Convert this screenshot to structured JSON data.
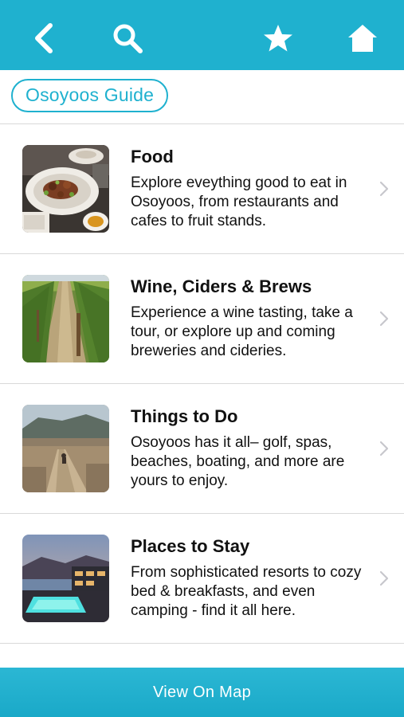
{
  "header": {
    "back_icon": "chevron-left-icon",
    "search_icon": "search-icon",
    "favorite_icon": "star-icon",
    "home_icon": "home-icon",
    "color": "#1fb1cf"
  },
  "breadcrumb": {
    "label": "Osoyoos Guide"
  },
  "categories": [
    {
      "title": "Food",
      "description": "Explore eveything good to eat in Osoyoos, from restaurants and cafes to fruit stands.",
      "thumbnail": "food-photo"
    },
    {
      "title": "Wine, Ciders & Brews",
      "description": "Experience a wine tasting, take a tour, or explore up and coming breweries and cideries.",
      "thumbnail": "vineyard-photo"
    },
    {
      "title": "Things to Do",
      "description": "Osoyoos has it all– golf, spas, beaches, boating, and more are yours to enjoy.",
      "thumbnail": "boardwalk-photo"
    },
    {
      "title": "Places to Stay",
      "description": "From sophisticated resorts to cozy bed & breakfasts, and even camping - find it all here.",
      "thumbnail": "resort-photo"
    }
  ],
  "footer": {
    "map_button_label": "View On Map"
  }
}
